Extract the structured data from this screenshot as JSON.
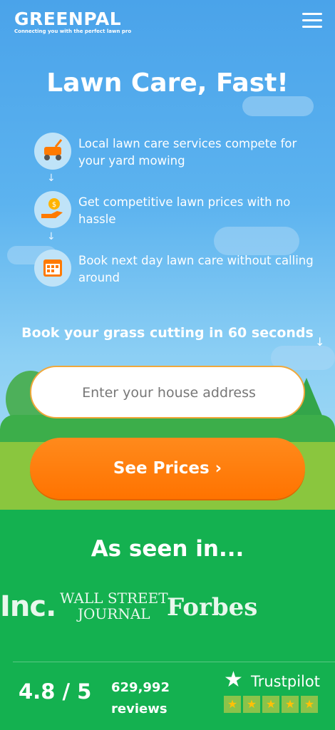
{
  "header": {
    "logo": "GREENPAL",
    "tagline": "Connecting you with the perfect lawn pro",
    "menu_icon": "hamburger-menu-icon"
  },
  "hero": {
    "title": "Lawn Care, Fast!",
    "features": [
      {
        "icon": "lawn-mower-icon",
        "text": "Local lawn care services compete for your yard mowing"
      },
      {
        "icon": "hand-money-icon",
        "text": "Get competitive lawn prices with no hassle"
      },
      {
        "icon": "calendar-icon",
        "text": "Book next day lawn care without calling around"
      }
    ],
    "book_text": "Book your grass cutting in 60 seconds",
    "address_placeholder": "Enter your house address",
    "cta_label": "See Prices ›"
  },
  "press": {
    "title": "As seen in...",
    "inc": "Inc.",
    "wsj_line1": "WALL STREET",
    "wsj_line2": "JOURNAL",
    "forbes": "Forbes"
  },
  "reviews": {
    "rating": "4.8 / 5",
    "count": "629,992",
    "count_label": "reviews",
    "trustpilot": "Trustpilot"
  },
  "colors": {
    "accent_orange": "#ff7a00",
    "brand_green": "#14b150",
    "sky_blue": "#4aa3ea"
  }
}
